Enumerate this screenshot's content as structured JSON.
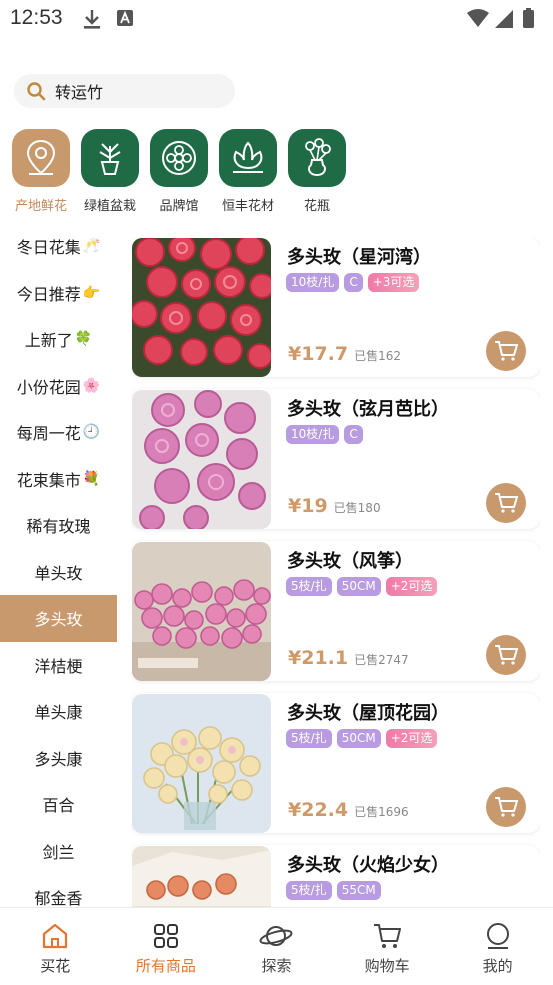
{
  "status_bar": {
    "time": "12:53"
  },
  "search": {
    "value": "转运竹"
  },
  "categories": [
    {
      "label": "产地鲜花",
      "icon": "origin-pin-icon",
      "active": true
    },
    {
      "label": "绿植盆栽",
      "icon": "potted-plant-icon",
      "active": false
    },
    {
      "label": "品牌馆",
      "icon": "flower-badge-icon",
      "active": false
    },
    {
      "label": "恒丰花材",
      "icon": "flower-material-icon",
      "active": false
    },
    {
      "label": "花瓶",
      "icon": "vase-icon",
      "active": false
    }
  ],
  "sidebar": {
    "items": [
      {
        "label": "冬日花集",
        "emoji": "🥂"
      },
      {
        "label": "今日推荐",
        "emoji": "👉"
      },
      {
        "label": "上新了",
        "emoji": "🍀"
      },
      {
        "label": "小份花园",
        "emoji": "🌸"
      },
      {
        "label": "每周一花",
        "emoji": "🕘"
      },
      {
        "label": "花束集市",
        "emoji": "💐"
      },
      {
        "label": "稀有玫瑰",
        "emoji": ""
      },
      {
        "label": "单头玫",
        "emoji": ""
      },
      {
        "label": "多头玫",
        "emoji": "",
        "active": true
      },
      {
        "label": "洋桔梗",
        "emoji": ""
      },
      {
        "label": "单头康",
        "emoji": ""
      },
      {
        "label": "多头康",
        "emoji": ""
      },
      {
        "label": "百合",
        "emoji": ""
      },
      {
        "label": "剑兰",
        "emoji": ""
      },
      {
        "label": "郁金香",
        "emoji": ""
      }
    ]
  },
  "products": [
    {
      "name": "多头玫（星河湾）",
      "tags": [
        "10枝/扎",
        "C"
      ],
      "extra_tag": "+3可选",
      "price": "¥17.7",
      "sold": "已售162",
      "image": "red-spray-roses"
    },
    {
      "name": "多头玫（弦月芭比）",
      "tags": [
        "10枝/扎",
        "C"
      ],
      "extra_tag": "",
      "price": "¥19",
      "sold": "已售180",
      "image": "pink-spray-roses"
    },
    {
      "name": "多头玫（风筝）",
      "tags": [
        "5枝/扎",
        "50CM"
      ],
      "extra_tag": "+2可选",
      "price": "¥21.1",
      "sold": "已售2747",
      "image": "pink-rose-box"
    },
    {
      "name": "多头玫（屋顶花园）",
      "tags": [
        "5枝/扎",
        "50CM"
      ],
      "extra_tag": "+2可选",
      "price": "¥22.4",
      "sold": "已售1696",
      "image": "cream-rose-vase"
    },
    {
      "name": "多头玫（火焰少女）",
      "tags": [
        "5枝/扎",
        "55CM"
      ],
      "extra_tag": "",
      "price": "",
      "sold": "",
      "image": "orange-roses-wrapped"
    }
  ],
  "bottom_nav": [
    {
      "label": "买花",
      "icon": "home-icon"
    },
    {
      "label": "所有商品",
      "icon": "grid-icon"
    },
    {
      "label": "探索",
      "icon": "planet-icon"
    },
    {
      "label": "购物车",
      "icon": "cart-icon"
    },
    {
      "label": "我的",
      "icon": "profile-icon"
    }
  ],
  "colors": {
    "accent": "#c9996e",
    "green": "#1f6b45",
    "nav_active": "#e3762e",
    "tag_purple": "#b89be0"
  }
}
